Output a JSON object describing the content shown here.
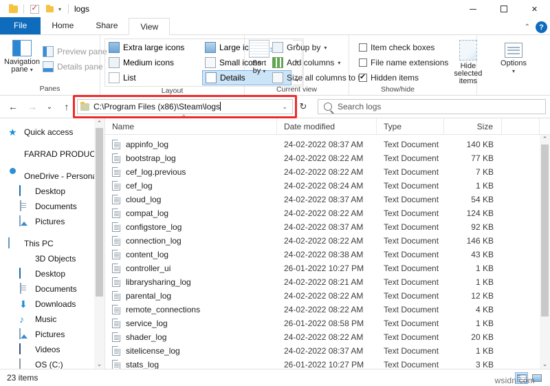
{
  "window": {
    "title": "logs",
    "minimize_label": "—",
    "maximize_label": "□",
    "close_label": "✕",
    "collapse_ribbon_label": "⌃",
    "help_label": "?"
  },
  "quick_access": {
    "folder_icon": "folder-icon",
    "properties_icon": "properties-checkbox-icon",
    "new_folder_icon": "new-folder-icon",
    "customize_caret": "▾"
  },
  "tabs": [
    {
      "label": "File",
      "id": "file"
    },
    {
      "label": "Home",
      "id": "home"
    },
    {
      "label": "Share",
      "id": "share"
    },
    {
      "label": "View",
      "id": "view",
      "active": true
    }
  ],
  "ribbon": {
    "panes": {
      "group_label": "Panes",
      "navigation_pane": "Navigation\npane",
      "navigation_pane_line1": "Navigation",
      "navigation_pane_line2": "pane",
      "preview_pane": "Preview pane",
      "details_pane": "Details pane"
    },
    "layout": {
      "group_label": "Layout",
      "items": [
        "Extra large icons",
        "Large icons",
        "Medium icons",
        "Small icons",
        "List",
        "Details"
      ],
      "selected": "Details",
      "scroll_up": "▴",
      "scroll_down": "▾",
      "scroll_more": "▾"
    },
    "current_view": {
      "group_label": "Current view",
      "sort_by_line1": "Sort",
      "sort_by_line2": "by",
      "group_by": "Group by",
      "add_columns": "Add columns",
      "size_all_columns": "Size all columns to fit"
    },
    "show_hide": {
      "group_label": "Show/hide",
      "item_check_boxes": "Item check boxes",
      "item_check_boxes_checked": false,
      "file_name_extensions": "File name extensions",
      "file_name_extensions_checked": false,
      "hidden_items": "Hidden items",
      "hidden_items_checked": true,
      "hide_selected_line1": "Hide selected",
      "hide_selected_line2": "items"
    },
    "options": {
      "label": "Options",
      "caret": "▾"
    }
  },
  "address": {
    "back_icon": "←",
    "forward_icon": "→",
    "recent_icon": "⌄",
    "up_icon": "↑",
    "path": "C:\\Program Files (x86)\\Steam\\logs",
    "dropdown_caret": "⌄",
    "refresh_icon": "↻",
    "highlight_color": "#ef2929"
  },
  "search": {
    "placeholder": "Search logs",
    "icon": "search-icon"
  },
  "sidebar": {
    "items": [
      {
        "label": "Quick access",
        "icon": "star-icon",
        "indent": false,
        "gap": false
      },
      {
        "label": "FARRAD PRODUCTION",
        "icon": "building-icon",
        "indent": false,
        "gap": true
      },
      {
        "label": "OneDrive - Personal",
        "icon": "cloud-icon",
        "indent": false,
        "gap": true
      },
      {
        "label": "Desktop",
        "icon": "desktop-icon",
        "indent": true,
        "gap": false
      },
      {
        "label": "Documents",
        "icon": "documents-icon",
        "indent": true,
        "gap": false
      },
      {
        "label": "Pictures",
        "icon": "pictures-icon",
        "indent": true,
        "gap": false
      },
      {
        "label": "This PC",
        "icon": "this-pc-icon",
        "indent": false,
        "gap": true
      },
      {
        "label": "3D Objects",
        "icon": "3d-objects-icon",
        "indent": true,
        "gap": false
      },
      {
        "label": "Desktop",
        "icon": "desktop-icon",
        "indent": true,
        "gap": false
      },
      {
        "label": "Documents",
        "icon": "documents-icon",
        "indent": true,
        "gap": false
      },
      {
        "label": "Downloads",
        "icon": "download-icon",
        "indent": true,
        "gap": false
      },
      {
        "label": "Music",
        "icon": "music-icon",
        "indent": true,
        "gap": false
      },
      {
        "label": "Pictures",
        "icon": "pictures-icon",
        "indent": true,
        "gap": false
      },
      {
        "label": "Videos",
        "icon": "videos-icon",
        "indent": true,
        "gap": false
      },
      {
        "label": "OS (C:)",
        "icon": "drive-icon",
        "indent": true,
        "gap": false
      }
    ],
    "scroll_up": "⌃",
    "scroll_down": "⌄"
  },
  "file_list": {
    "columns": [
      "Name",
      "Date modified",
      "Type",
      "Size"
    ],
    "sort_indicator": "⌃",
    "sort_column": "Name",
    "rows": [
      {
        "name": "appinfo_log",
        "date": "24-02-2022 08:37 AM",
        "type": "Text Document",
        "size": "140 KB"
      },
      {
        "name": "bootstrap_log",
        "date": "24-02-2022 08:22 AM",
        "type": "Text Document",
        "size": "77 KB"
      },
      {
        "name": "cef_log.previous",
        "date": "24-02-2022 08:22 AM",
        "type": "Text Document",
        "size": "7 KB"
      },
      {
        "name": "cef_log",
        "date": "24-02-2022 08:24 AM",
        "type": "Text Document",
        "size": "1 KB"
      },
      {
        "name": "cloud_log",
        "date": "24-02-2022 08:37 AM",
        "type": "Text Document",
        "size": "54 KB"
      },
      {
        "name": "compat_log",
        "date": "24-02-2022 08:22 AM",
        "type": "Text Document",
        "size": "124 KB"
      },
      {
        "name": "configstore_log",
        "date": "24-02-2022 08:37 AM",
        "type": "Text Document",
        "size": "92 KB"
      },
      {
        "name": "connection_log",
        "date": "24-02-2022 08:22 AM",
        "type": "Text Document",
        "size": "146 KB"
      },
      {
        "name": "content_log",
        "date": "24-02-2022 08:38 AM",
        "type": "Text Document",
        "size": "43 KB"
      },
      {
        "name": "controller_ui",
        "date": "26-01-2022 10:27 PM",
        "type": "Text Document",
        "size": "1 KB"
      },
      {
        "name": "librarysharing_log",
        "date": "24-02-2022 08:21 AM",
        "type": "Text Document",
        "size": "1 KB"
      },
      {
        "name": "parental_log",
        "date": "24-02-2022 08:22 AM",
        "type": "Text Document",
        "size": "12 KB"
      },
      {
        "name": "remote_connections",
        "date": "24-02-2022 08:22 AM",
        "type": "Text Document",
        "size": "4 KB"
      },
      {
        "name": "service_log",
        "date": "26-01-2022 08:58 PM",
        "type": "Text Document",
        "size": "1 KB"
      },
      {
        "name": "shader_log",
        "date": "24-02-2022 08:22 AM",
        "type": "Text Document",
        "size": "20 KB"
      },
      {
        "name": "sitelicense_log",
        "date": "24-02-2022 08:37 AM",
        "type": "Text Document",
        "size": "1 KB"
      },
      {
        "name": "stats_log",
        "date": "26-01-2022 10:27 PM",
        "type": "Text Document",
        "size": "3 KB"
      }
    ],
    "scroll_up": "⌃",
    "scroll_down": "⌄"
  },
  "status": {
    "item_count": "23 items",
    "details_view_icon": "details-view-icon",
    "thumbnail_view_icon": "large-icons-view-icon",
    "watermark": "wsidn.com"
  }
}
